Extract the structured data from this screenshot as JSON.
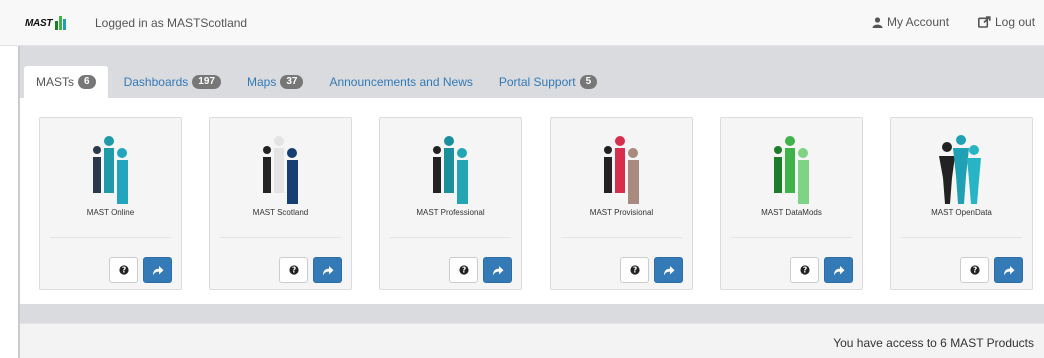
{
  "header": {
    "logo_text": "MAST",
    "logged_in_text": "Logged in as MASTScotland",
    "my_account_label": "My Account",
    "logout_label": "Log out"
  },
  "tabs": [
    {
      "label": "MASTs",
      "badge": "6",
      "active": true
    },
    {
      "label": "Dashboards",
      "badge": "197",
      "active": false
    },
    {
      "label": "Maps",
      "badge": "37",
      "active": false
    },
    {
      "label": "Announcements and News",
      "badge": "",
      "active": false
    },
    {
      "label": "Portal Support",
      "badge": "5",
      "active": false
    }
  ],
  "products": [
    {
      "title": "MAST Online",
      "icon": "people-teal-icon",
      "colors": [
        "#2a3a4a",
        "#1f9aa8",
        "#22a6c0"
      ]
    },
    {
      "title": "MAST Scotland",
      "icon": "people-navy-icon",
      "colors": [
        "#222222",
        "#e4e4e4",
        "#163e73"
      ]
    },
    {
      "title": "MAST Professional",
      "icon": "people-teal-dark-icon",
      "colors": [
        "#222222",
        "#1c8f9c",
        "#23a5b3"
      ]
    },
    {
      "title": "MAST Provisional",
      "icon": "people-red-icon",
      "colors": [
        "#222222",
        "#d62e4d",
        "#a88b7e"
      ]
    },
    {
      "title": "MAST DataMods",
      "icon": "people-green-icon",
      "colors": [
        "#1e7d2a",
        "#3fb34a",
        "#7fd384"
      ]
    },
    {
      "title": "MAST OpenData",
      "icon": "people-black-teal-icon",
      "colors": [
        "#222222",
        "#1fa0b4",
        "#27b5c6"
      ]
    }
  ],
  "card_help_symbol": "?",
  "footer": {
    "access_text": "You have access to 6 MAST Products"
  }
}
